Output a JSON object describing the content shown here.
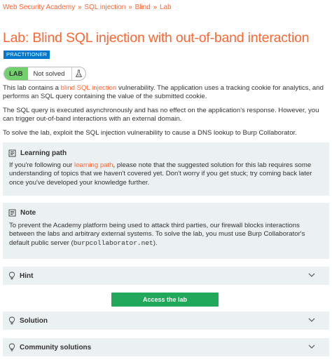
{
  "breadcrumb": {
    "items": [
      "Web Security Academy",
      "SQL injection",
      "Blind",
      "Lab"
    ],
    "separator": "»"
  },
  "title": "Lab: Blind SQL injection with out-of-band interaction",
  "level": "PRACTITIONER",
  "status": {
    "lab_label": "LAB",
    "text": "Not solved"
  },
  "description": {
    "p1_before": "This lab contains a ",
    "p1_link": "blind SQL injection",
    "p1_after": " vulnerability. The application uses a tracking cookie for analytics, and performs an SQL query containing the value of the submitted cookie.",
    "p2": "The SQL query is executed asynchronously and has no effect on the application's response. However, you can trigger out-of-band interactions with an external domain.",
    "p3": "To solve the lab, exploit the SQL injection vulnerability to cause a DNS lookup to Burp Collaborator."
  },
  "learning_path": {
    "heading": "Learning path",
    "before": "If you're following our ",
    "link": "learning path",
    "after": ", please note that the suggested solution for this lab requires some understanding of topics that we haven't covered yet. Don't worry if you get stuck; try coming back later once you've developed your knowledge further."
  },
  "note": {
    "heading": "Note",
    "before": "To prevent the Academy platform being used to attack third parties, our firewall blocks interactions between the labs and arbitrary external systems. To solve the lab, you must use Burp Collaborator's default public server (",
    "code": "burpcollaborator.net",
    "after": ")."
  },
  "hint": {
    "label": "Hint"
  },
  "access_button": "Access the lab",
  "solution": {
    "label": "Solution"
  },
  "community": {
    "label": "Community solutions"
  },
  "colors": {
    "accent": "#ff6633",
    "badge": "#0077cc",
    "lab_green": "#70d16d",
    "button_green": "#21a85a",
    "panel": "#ebf0f2"
  }
}
